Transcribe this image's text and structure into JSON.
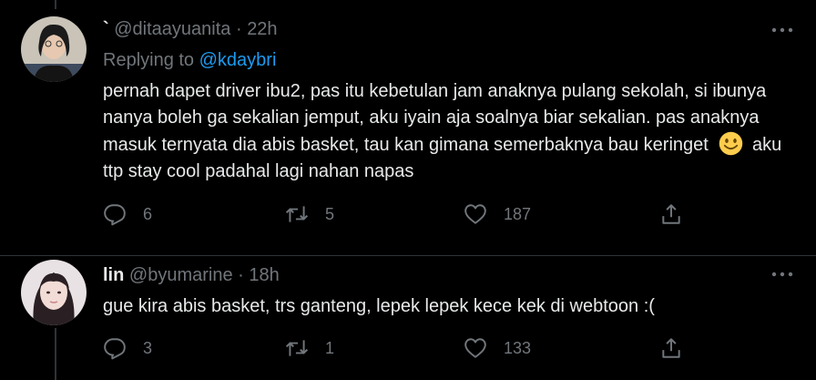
{
  "tweets": [
    {
      "name": "`",
      "handle": "@ditaayuanita",
      "time": "22h",
      "replying_label": "Replying to",
      "replying_handle": "@kdaybri",
      "text_before_emoji": "pernah dapet driver ibu2, pas itu kebetulan jam anaknya pulang sekolah, si ibunya nanya boleh ga sekalian jemput, aku iyain aja soalnya biar sekalian. pas anaknya masuk ternyata dia abis basket, tau kan gimana semerbaknya bau keringet",
      "emoji": "slightly-smiling-face-emoji",
      "text_after_emoji": "aku ttp stay cool padahal lagi nahan napas",
      "replies": "6",
      "retweets": "5",
      "likes": "187"
    },
    {
      "name": "lin",
      "handle": "@byumarine",
      "time": "18h",
      "text": "gue kira abis basket, trs ganteng, lepek lepek kece kek di webtoon :(",
      "replies": "3",
      "retweets": "1",
      "likes": "133"
    }
  ],
  "colors": {
    "background": "#000000",
    "text": "#e7e9ea",
    "muted": "#71767b",
    "link": "#1d9bf0",
    "divider": "#2f3336"
  }
}
